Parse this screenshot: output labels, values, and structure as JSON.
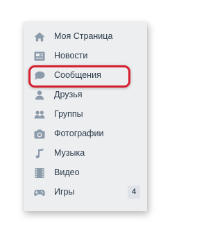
{
  "menu": {
    "items": [
      {
        "id": "my-page",
        "label": "Моя Страница",
        "icon": "home-icon"
      },
      {
        "id": "news",
        "label": "Новости",
        "icon": "newspaper-icon"
      },
      {
        "id": "messages",
        "label": "Сообщения",
        "icon": "chat-bubble-icon",
        "highlighted": true
      },
      {
        "id": "friends",
        "label": "Друзья",
        "icon": "person-icon"
      },
      {
        "id": "groups",
        "label": "Группы",
        "icon": "people-icon"
      },
      {
        "id": "photos",
        "label": "Фотографии",
        "icon": "camera-icon"
      },
      {
        "id": "music",
        "label": "Музыка",
        "icon": "music-note-icon"
      },
      {
        "id": "video",
        "label": "Видео",
        "icon": "film-icon"
      },
      {
        "id": "games",
        "label": "Игры",
        "icon": "gamepad-icon",
        "badge": "4"
      }
    ]
  },
  "colors": {
    "panel_background": "#edeef0",
    "icon": "#8c9baa",
    "label_text": "#2a3a4a",
    "highlight_ring": "#d61f2e",
    "badge_background": "#dfe3e8"
  }
}
